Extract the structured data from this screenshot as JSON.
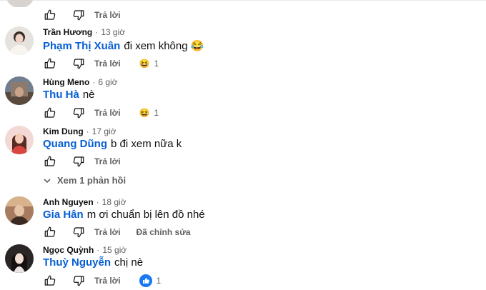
{
  "comments": [
    {
      "author": "Trần Hương",
      "time": "13 giờ",
      "mention": "Phạm Thị Xuân",
      "text": "đi xem không",
      "text_emoji": "😂",
      "reply_label": "Trả lời",
      "reaction_emoji": "😆",
      "reaction_count": "1"
    },
    {
      "author": "Hùng Meno",
      "time": "6 giờ",
      "mention": "Thu Hà",
      "text": "nè",
      "reply_label": "Trả lời",
      "reaction_emoji": "😆",
      "reaction_count": "1"
    },
    {
      "author": "Kim Dung",
      "time": "17 giờ",
      "mention": "Quang Dũng",
      "text": "b đi xem nữa k",
      "reply_label": "Trả lời",
      "view_replies": "Xem 1 phản hồi"
    },
    {
      "author": "Anh Nguyen",
      "time": "18 giờ",
      "mention": "Gia Hân",
      "text": "m ơi chuẩn bị lên đồ nhé",
      "reply_label": "Trả lời",
      "pinned_label": "Đã chỉnh sửa"
    },
    {
      "author": "Ngọc Quỳnh",
      "time": "15 giờ",
      "mention": "Thuỳ Nguyễn",
      "text": "chị nè",
      "reply_label": "Trả lời",
      "reaction_icon": "like-reaction-icon",
      "reaction_count": "1"
    }
  ],
  "top_reply_label": "Trả lời",
  "colors": {
    "link": "#065fd4",
    "meta": "#606060",
    "like_blue": "#1877f2"
  }
}
